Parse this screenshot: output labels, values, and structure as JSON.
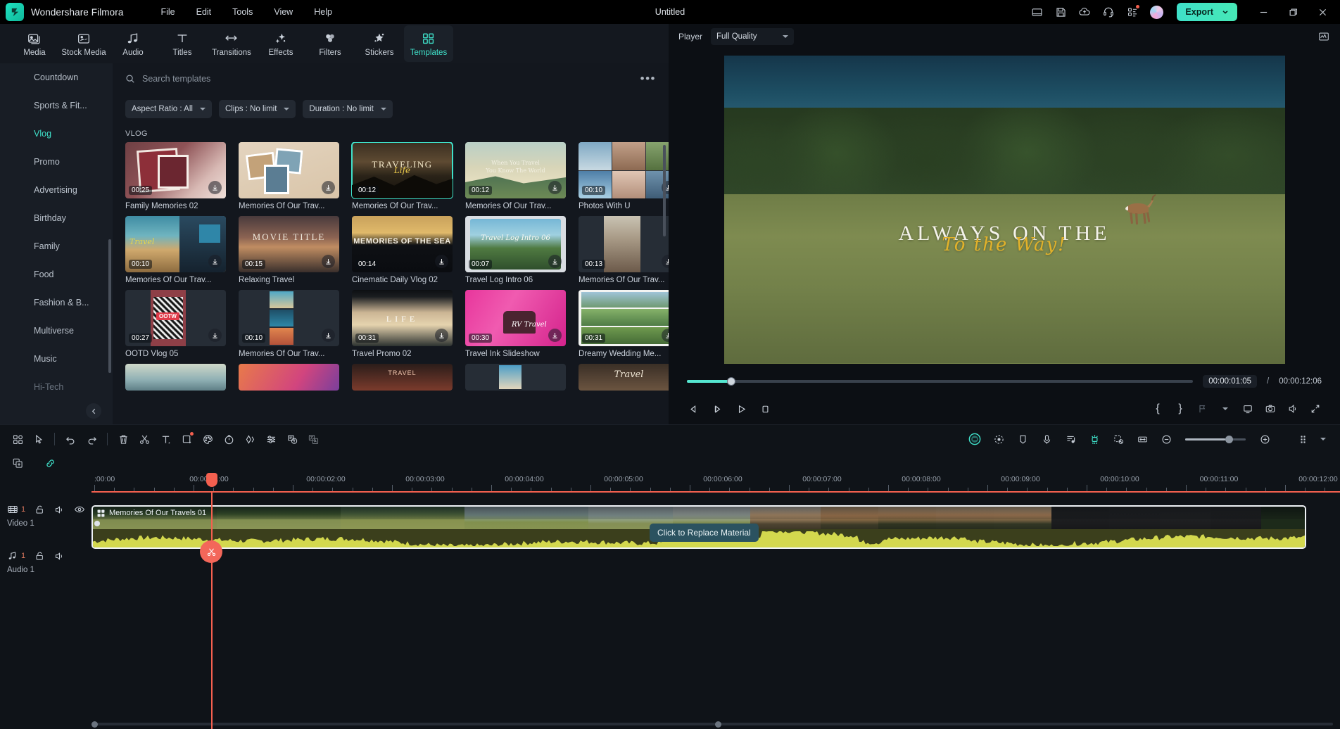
{
  "titlebar": {
    "app_name": "Wondershare Filmora",
    "menus": [
      "File",
      "Edit",
      "Tools",
      "View",
      "Help"
    ],
    "document_title": "Untitled",
    "icons": [
      "layout-icon",
      "save-icon",
      "cloud-upload-icon",
      "support-headset-icon",
      "apps-grid-icon"
    ],
    "export_label": "Export",
    "accent": "#3fe0c9"
  },
  "ribbon": {
    "items": [
      {
        "label": "Media",
        "icon": "media-icon",
        "active": false
      },
      {
        "label": "Stock Media",
        "icon": "stock-media-icon",
        "active": false
      },
      {
        "label": "Audio",
        "icon": "audio-note-icon",
        "active": false
      },
      {
        "label": "Titles",
        "icon": "titles-text-icon",
        "active": false
      },
      {
        "label": "Transitions",
        "icon": "transitions-icon",
        "active": false
      },
      {
        "label": "Effects",
        "icon": "effects-sparkle-icon",
        "active": false
      },
      {
        "label": "Filters",
        "icon": "filters-circles-icon",
        "active": false
      },
      {
        "label": "Stickers",
        "icon": "stickers-icon",
        "active": false
      },
      {
        "label": "Templates",
        "icon": "templates-grid-icon",
        "active": true
      }
    ]
  },
  "categories": [
    {
      "label": "Countdown",
      "active": false,
      "dim": false
    },
    {
      "label": "Sports & Fit...",
      "active": false,
      "dim": false
    },
    {
      "label": "Vlog",
      "active": true,
      "dim": false
    },
    {
      "label": "Promo",
      "active": false,
      "dim": false
    },
    {
      "label": "Advertising",
      "active": false,
      "dim": false
    },
    {
      "label": "Birthday",
      "active": false,
      "dim": false
    },
    {
      "label": "Family",
      "active": false,
      "dim": false
    },
    {
      "label": "Food",
      "active": false,
      "dim": false
    },
    {
      "label": "Fashion & B...",
      "active": false,
      "dim": false
    },
    {
      "label": "Multiverse",
      "active": false,
      "dim": false
    },
    {
      "label": "Music",
      "active": false,
      "dim": false
    },
    {
      "label": "Hi-Tech",
      "active": false,
      "dim": true
    }
  ],
  "search": {
    "placeholder": "Search templates",
    "value": "",
    "more_label": "•••"
  },
  "filters": [
    {
      "label": "Aspect Ratio : All"
    },
    {
      "label": "Clips : No limit"
    },
    {
      "label": "Duration : No limit"
    }
  ],
  "section_title": "VLOG",
  "templates_rows": [
    [
      {
        "name": "Family Memories 02",
        "duration": "00:25",
        "selected": false,
        "download": true
      },
      {
        "name": "Memories Of Our Trav...",
        "duration": "",
        "selected": false,
        "download": true
      },
      {
        "name": "Memories Of Our Trav...",
        "duration": "00:12",
        "selected": true,
        "download": false
      },
      {
        "name": "Memories Of Our Trav...",
        "duration": "00:12",
        "selected": false,
        "download": true
      },
      {
        "name": "Photos With U",
        "duration": "00:10",
        "selected": false,
        "download": true
      }
    ],
    [
      {
        "name": "Memories Of Our Trav...",
        "duration": "00:10",
        "selected": false,
        "download": true
      },
      {
        "name": "Relaxing Travel",
        "duration": "00:15",
        "selected": false,
        "download": true
      },
      {
        "name": "Cinematic Daily Vlog 02",
        "duration": "00:14",
        "selected": false,
        "download": true
      },
      {
        "name": "Travel Log Intro 06",
        "duration": "00:07",
        "selected": false,
        "download": true
      },
      {
        "name": "Memories Of Our Trav...",
        "duration": "00:13",
        "selected": false,
        "download": true
      }
    ],
    [
      {
        "name": "OOTD Vlog 05",
        "duration": "00:27",
        "selected": false,
        "download": true
      },
      {
        "name": "Memories Of Our Trav...",
        "duration": "00:10",
        "selected": false,
        "download": true
      },
      {
        "name": "Travel Promo 02",
        "duration": "00:31",
        "selected": false,
        "download": true
      },
      {
        "name": "Travel Ink Slideshow",
        "duration": "00:30",
        "selected": false,
        "download": true
      },
      {
        "name": "Dreamy Wedding Me...",
        "duration": "00:31",
        "selected": false,
        "download": true
      }
    ]
  ],
  "player": {
    "label": "Player",
    "quality": "Full Quality",
    "current_time": "00:00:01:05",
    "separator": "/",
    "total_time": "00:00:12:06",
    "progress_percent": 8.7,
    "overlay_line1": "ALWAYS ON THE",
    "overlay_line2": "To the Way!",
    "controls": [
      {
        "name": "prev-frame-button"
      },
      {
        "name": "next-frame-button"
      },
      {
        "name": "play-button"
      },
      {
        "name": "stop-button"
      }
    ],
    "right_controls": [
      {
        "name": "mark-in-button",
        "label": "{"
      },
      {
        "name": "mark-out-button",
        "label": "}"
      },
      {
        "name": "export-frame-button",
        "label": ""
      },
      {
        "name": "split-screen-button",
        "label": ""
      },
      {
        "name": "snapshot-button",
        "label": ""
      },
      {
        "name": "volume-button",
        "label": ""
      },
      {
        "name": "fullscreen-button",
        "label": ""
      }
    ]
  },
  "timeline": {
    "tools_left": [
      {
        "name": "smart-tools-icon"
      },
      {
        "name": "select-cursor-icon"
      },
      {
        "name": "undo-icon"
      },
      {
        "name": "redo-icon"
      },
      {
        "name": "delete-icon"
      },
      {
        "name": "split-scissors-icon"
      },
      {
        "name": "text-tool-icon"
      },
      {
        "name": "crop-icon"
      },
      {
        "name": "color-palette-icon"
      },
      {
        "name": "speed-timer-icon"
      },
      {
        "name": "keyframe-icon"
      },
      {
        "name": "audio-mixer-icon"
      },
      {
        "name": "auto-caption-icon"
      },
      {
        "name": "translate-icon"
      }
    ],
    "tools_right": [
      {
        "name": "ai-mask-icon"
      },
      {
        "name": "motion-tracking-icon"
      },
      {
        "name": "marker-icon"
      },
      {
        "name": "record-voiceover-icon"
      },
      {
        "name": "audio-ducking-icon"
      },
      {
        "name": "green-screen-icon"
      },
      {
        "name": "background-remove-icon"
      },
      {
        "name": "fit-timeline-icon"
      },
      {
        "name": "zoom-out-icon"
      },
      {
        "name": "zoom-in-icon"
      },
      {
        "name": "track-settings-icon"
      }
    ],
    "header_icons": [
      {
        "name": "add-track-icon"
      },
      {
        "name": "link-clips-icon"
      }
    ],
    "ruler_labels": [
      ":00:00",
      "00:00:01:00",
      "00:00:02:00",
      "00:00:03:00",
      "00:00:04:00",
      "00:00:05:00",
      "00:00:06:00",
      "00:00:07:00",
      "00:00:08:00",
      "00:00:09:00",
      "00:00:10:00",
      "00:00:11:00",
      "00:00:12:00"
    ],
    "tracks": [
      {
        "name": "Video 1",
        "number": "1",
        "icon": "video-track-icon",
        "has_eye": true
      },
      {
        "name": "Audio 1",
        "number": "1",
        "icon": "audio-track-icon",
        "has_eye": false
      }
    ],
    "clip": {
      "title": "Memories Of Our Travels 01",
      "icon": "template-clip-icon"
    },
    "tooltip": "Click to Replace Material",
    "playhead_time": "00:00:01:05"
  }
}
